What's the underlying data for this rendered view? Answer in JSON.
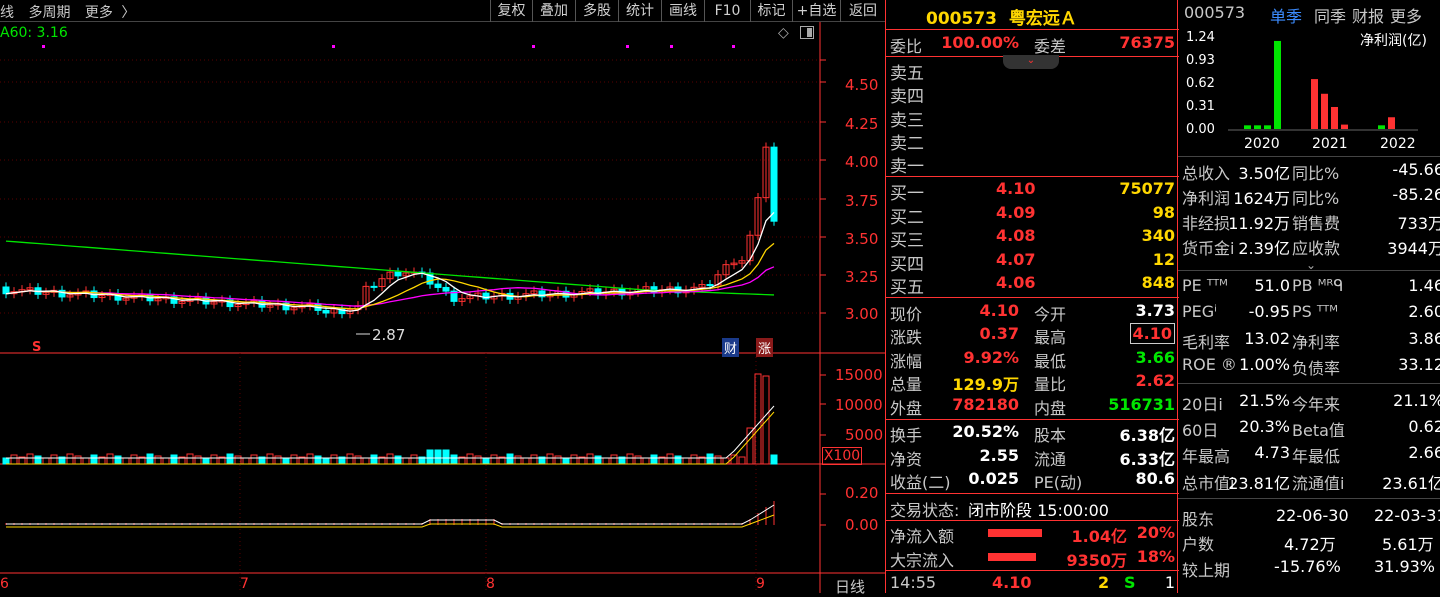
{
  "toolbar": {
    "left_text_1": "线",
    "left_text_2": "多周期",
    "left_text_3": "更多",
    "left_text_3_arrow": "〉",
    "buttons": [
      "复权",
      "叠加",
      "多股",
      "统计",
      "画线",
      "F10",
      "标记",
      "+自选",
      "返回"
    ]
  },
  "chart": {
    "ma_label": "A60: 3.16",
    "price_ticks": [
      "4.50",
      "4.25",
      "4.00",
      "3.75",
      "3.50",
      "3.25",
      "3.00"
    ],
    "low_marker": "2.87",
    "vol_ticks": [
      "15000",
      "10000",
      "5000"
    ],
    "vol_unit": "X100",
    "macd_ticks": [
      "0.20",
      "0.00"
    ],
    "month_labels": [
      "6",
      "7",
      "8",
      "9"
    ],
    "period_label": "日线",
    "badge_s": "S",
    "badge_cai": "财",
    "badge_zhang": "涨",
    "colors": {
      "up": "#ff3232",
      "down": "#00ffff",
      "ma5": "#ffffff",
      "ma10": "#ffd700",
      "ma20": "#ff00ff",
      "ma60": "#00e600"
    }
  },
  "quote": {
    "code": "000573",
    "name": "粤宏远Ａ",
    "weibi_label": "委比",
    "weibi": "100.00%",
    "weicha_label": "委差",
    "weicha": "76375",
    "sell": [
      {
        "label": "卖五",
        "price": "",
        "vol": ""
      },
      {
        "label": "卖四",
        "price": "",
        "vol": ""
      },
      {
        "label": "卖三",
        "price": "",
        "vol": ""
      },
      {
        "label": "卖二",
        "price": "",
        "vol": ""
      },
      {
        "label": "卖一",
        "price": "",
        "vol": ""
      }
    ],
    "buy": [
      {
        "label": "买一",
        "price": "4.10",
        "vol": "75077"
      },
      {
        "label": "买二",
        "price": "4.09",
        "vol": "98"
      },
      {
        "label": "买三",
        "price": "4.08",
        "vol": "340"
      },
      {
        "label": "买四",
        "price": "4.07",
        "vol": "12"
      },
      {
        "label": "买五",
        "price": "4.06",
        "vol": "848"
      }
    ],
    "stats": [
      {
        "l1": "现价",
        "v1": "4.10",
        "c1": "red",
        "l2": "今开",
        "v2": "3.73",
        "c2": "white"
      },
      {
        "l1": "涨跌",
        "v1": "0.37",
        "c1": "red",
        "l2": "最高",
        "v2": "4.10",
        "c2": "red"
      },
      {
        "l1": "涨幅",
        "v1": "9.92%",
        "c1": "red",
        "l2": "最低",
        "v2": "3.66",
        "c2": "green"
      },
      {
        "l1": "总量",
        "v1": "129.9万",
        "c1": "yellow",
        "l2": "量比",
        "v2": "2.62",
        "c2": "red"
      },
      {
        "l1": "外盘",
        "v1": "782180",
        "c1": "red",
        "l2": "内盘",
        "v2": "516731",
        "c2": "green"
      }
    ],
    "stats2": [
      {
        "l1": "换手",
        "v1": "20.52%",
        "l2": "股本",
        "v2": "6.38亿"
      },
      {
        "l1": "净资",
        "v1": "2.55",
        "l2": "流通",
        "v2": "6.33亿"
      },
      {
        "l1": "收益(二)",
        "v1": "0.025",
        "l2": "PE(动)",
        "v2": "80.6"
      }
    ],
    "trade_status_label": "交易状态:",
    "trade_status": "闭市阶段 15:00:00",
    "flows": [
      {
        "label": "净流入额",
        "value": "1.04亿",
        "pct": "20%"
      },
      {
        "label": "大宗流入",
        "value": "9350万",
        "pct": "18%"
      }
    ],
    "tick": {
      "time": "14:55",
      "price": "4.10",
      "vol": "2",
      "side": "S",
      "num": "1"
    }
  },
  "finance": {
    "code": "000573",
    "tabs": [
      "单季",
      "同季",
      "财报",
      "更多"
    ],
    "chart_title": "净利润(亿)",
    "chart_data": {
      "type": "bar",
      "ylabel": "净利润(亿)",
      "yticks": [
        "1.24",
        "0.93",
        "0.62",
        "0.31",
        "0.00"
      ],
      "ylim": [
        0,
        1.24
      ],
      "categories": [
        "2020",
        "2021",
        "2022"
      ],
      "bars": [
        {
          "year": "2020",
          "values": [
            0.05,
            0.05,
            0.05,
            1.2
          ],
          "color": "#00e600"
        },
        {
          "year": "2021",
          "values": [
            0.68,
            0.48,
            0.3,
            0.06
          ],
          "color": "#ff3232"
        },
        {
          "year": "2022",
          "values": [
            0.05,
            0.16
          ],
          "colors": [
            "#00e600",
            "#ff3232"
          ]
        }
      ]
    },
    "rows": [
      {
        "l1": "总收入",
        "v1": "3.50亿",
        "l2": "同比%",
        "v2": "-45.66",
        "c2": "white"
      },
      {
        "l1": "净利润",
        "v1": "1624万",
        "l2": "同比%",
        "v2": "-85.26",
        "c2": "white"
      },
      {
        "l1": "非经损",
        "v1": "11.92万",
        "l2": "销售费",
        "v2": "733万",
        "c2": "white"
      },
      {
        "l1": "货币金i",
        "v1": "2.39亿",
        "l2": "应收款",
        "v2": "3944万",
        "c2": "white"
      }
    ],
    "rows2": [
      {
        "l1": "PE ᵀᵀᴹ",
        "v1": "51.0",
        "l2": "PB ᴹᴿᑫ",
        "v2": "1.46"
      },
      {
        "l1": "PEGⁱ",
        "v1": "-0.95",
        "l2": "PS ᵀᵀᴹ",
        "v2": "2.60"
      },
      {
        "l1": "毛利率",
        "v1": "13.02",
        "l2": "净利率",
        "v2": "3.86"
      },
      {
        "l1": "ROE ®",
        "v1": "1.00%",
        "l2": "负债率",
        "v2": "33.12"
      }
    ],
    "rows3": [
      {
        "l1": "20日i",
        "v1": "21.5%",
        "l2": "今年来",
        "v2": "21.1%"
      },
      {
        "l1": "60日",
        "v1": "20.3%",
        "l2": "Beta值",
        "v2": "0.62"
      },
      {
        "l1": "年最高",
        "v1": "4.73",
        "l2": "年最低",
        "v2": "2.66"
      },
      {
        "l1": "总市值i",
        "v1": "23.81亿",
        "l2": "流通值i",
        "v2": "23.61亿"
      }
    ],
    "holders": {
      "label": "股东",
      "d1": "22-06-30",
      "d2": "22-03-31",
      "rows": [
        {
          "l": "户数",
          "v1": "4.72万",
          "v2": "5.61万"
        },
        {
          "l": "较上期",
          "v1": "-15.76%",
          "v2": "31.93%"
        }
      ]
    }
  }
}
